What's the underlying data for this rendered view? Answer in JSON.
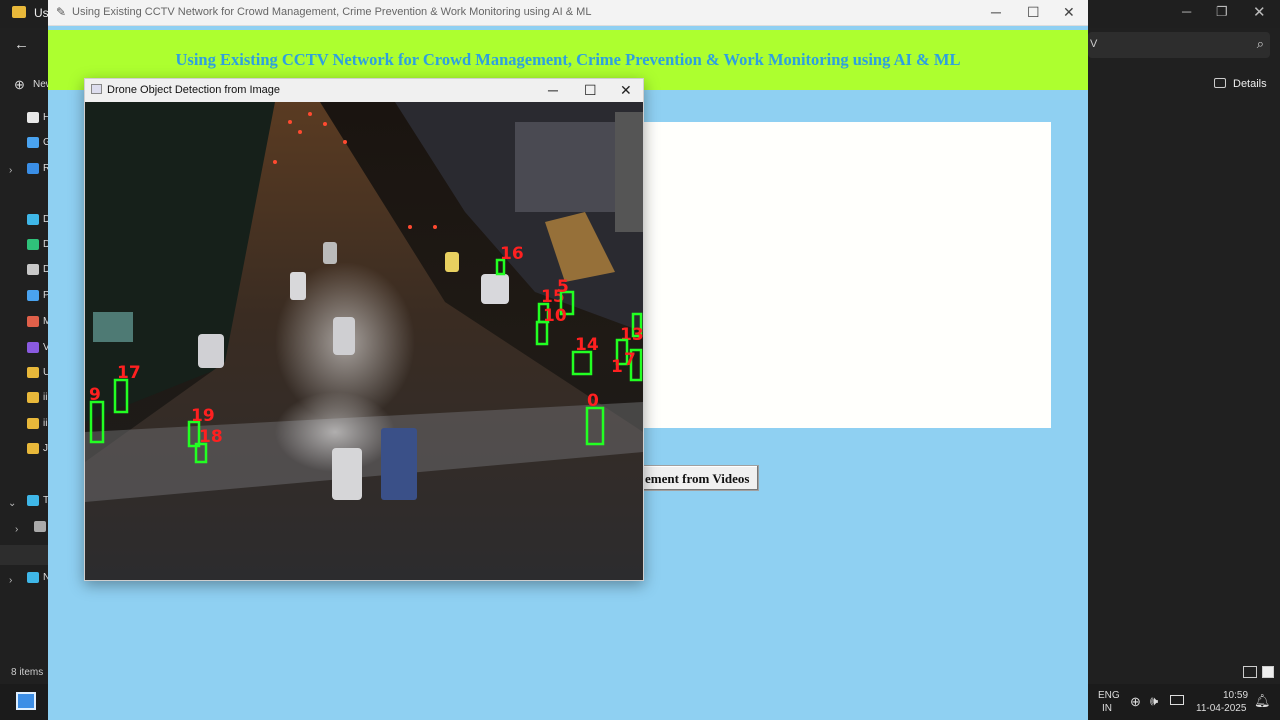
{
  "explorer": {
    "title_fragment": "Usi",
    "address_fragment": "V",
    "details_label": "Details",
    "new_label": "New",
    "sidebar": [
      {
        "label": "H",
        "color": "#e8e8e8"
      },
      {
        "label": "G",
        "color": "#4aa3f0"
      },
      {
        "label": "R",
        "color": "#3a8ee6"
      },
      {
        "label": "D",
        "color": "#3fb7e8"
      },
      {
        "label": "D",
        "color": "#2fc27a"
      },
      {
        "label": "D",
        "color": "#c8c8c8"
      },
      {
        "label": "P",
        "color": "#4aa3f0"
      },
      {
        "label": "M",
        "color": "#e0604a"
      },
      {
        "label": "V",
        "color": "#8a5ae0"
      },
      {
        "label": "U",
        "color": "#e8b83a"
      },
      {
        "label": "ii",
        "color": "#e8b83a"
      },
      {
        "label": "ii",
        "color": "#e8b83a"
      },
      {
        "label": "J",
        "color": "#e8b83a"
      },
      {
        "label": "T",
        "color": "#3fb7e8"
      },
      {
        "label": "",
        "color": "#aaaaaa"
      },
      {
        "label": "",
        "color": "#6aa0d0"
      },
      {
        "label": "N",
        "color": "#3fb7e8"
      }
    ],
    "items_count": "8 items"
  },
  "taskbar": {
    "lang_top": "ENG",
    "lang_bottom": "IN",
    "time": "10:59",
    "date": "11-04-2025"
  },
  "app": {
    "window_title": "Using Existing CCTV Network for Crowd Management, Crime Prevention & Work Monitoring using AI & ML",
    "heading": "Using Existing CCTV Network for Crowd Management, Crime Prevention & Work Monitoring using AI & ML",
    "button_label": "ement from Videos"
  },
  "cv_window": {
    "title": "Drone Object Detection from Image",
    "detections": [
      {
        "id": "9"
      },
      {
        "id": "17"
      },
      {
        "id": "19"
      },
      {
        "id": "18"
      },
      {
        "id": "16"
      },
      {
        "id": "15"
      },
      {
        "id": "5"
      },
      {
        "id": "10"
      },
      {
        "id": "14"
      },
      {
        "id": "13"
      },
      {
        "id": "1"
      },
      {
        "id": "7"
      },
      {
        "id": "0"
      }
    ]
  },
  "colors": {
    "banner": "#adff2f",
    "heading_text": "#2e9fe0",
    "app_bg": "#8fd0f2",
    "box": "#22ff22",
    "label": "#ff2020"
  }
}
